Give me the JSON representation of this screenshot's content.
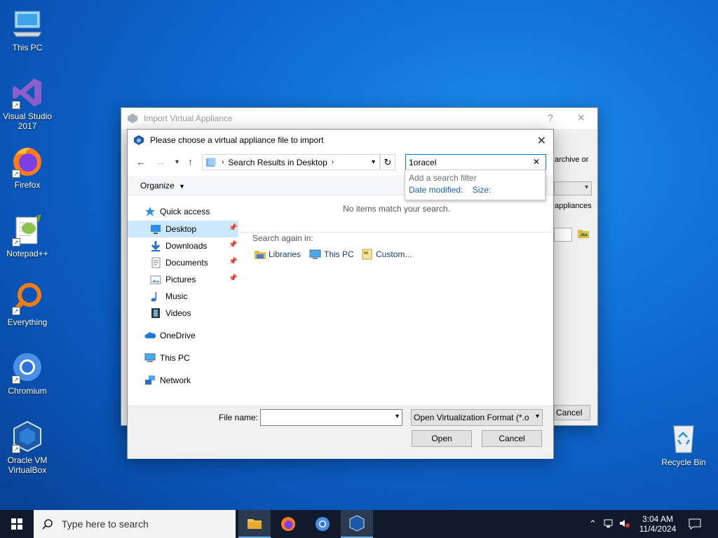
{
  "desktop": {
    "icons": [
      {
        "label": "This PC"
      },
      {
        "label": "Visual Studio 2017"
      },
      {
        "label": "Firefox"
      },
      {
        "label": "Notepad++"
      },
      {
        "label": "Everything"
      },
      {
        "label": "Chromium"
      },
      {
        "label": "Oracle VM VirtualBox"
      },
      {
        "label": "Recycle Bin"
      }
    ]
  },
  "bg_window": {
    "title": "Import Virtual Appliance",
    "help": "?",
    "close": "✕",
    "frag_archive": "archive or",
    "frag_appliances": "appliances",
    "frag_cancel": "Cancel"
  },
  "dialog": {
    "title": "Please choose a virtual appliance file to import",
    "address": {
      "crumb": "Search Results in Desktop"
    },
    "search": {
      "value": "1oracel"
    },
    "search_filter": {
      "heading": "Add a search filter",
      "option1": "Date modified:",
      "option2": "Size:"
    },
    "toolbar": {
      "organize": "Organize"
    },
    "nav": {
      "quick_access": "Quick access",
      "items": [
        {
          "label": "Desktop"
        },
        {
          "label": "Downloads"
        },
        {
          "label": "Documents"
        },
        {
          "label": "Pictures"
        },
        {
          "label": "Music"
        },
        {
          "label": "Videos"
        }
      ],
      "onedrive": "OneDrive",
      "this_pc": "This PC",
      "network": "Network"
    },
    "content": {
      "empty_msg": "No items match your search.",
      "search_again": "Search again in:",
      "locations": [
        "Libraries",
        "This PC",
        "Custom..."
      ]
    },
    "bottom": {
      "file_name_label": "File name:",
      "file_name_value": "",
      "file_type": "Open Virtualization Format (*.o",
      "open": "Open",
      "cancel": "Cancel"
    }
  },
  "taskbar": {
    "search_placeholder": "Type here to search",
    "time": "3:04 AM",
    "date": "11/4/2024"
  }
}
